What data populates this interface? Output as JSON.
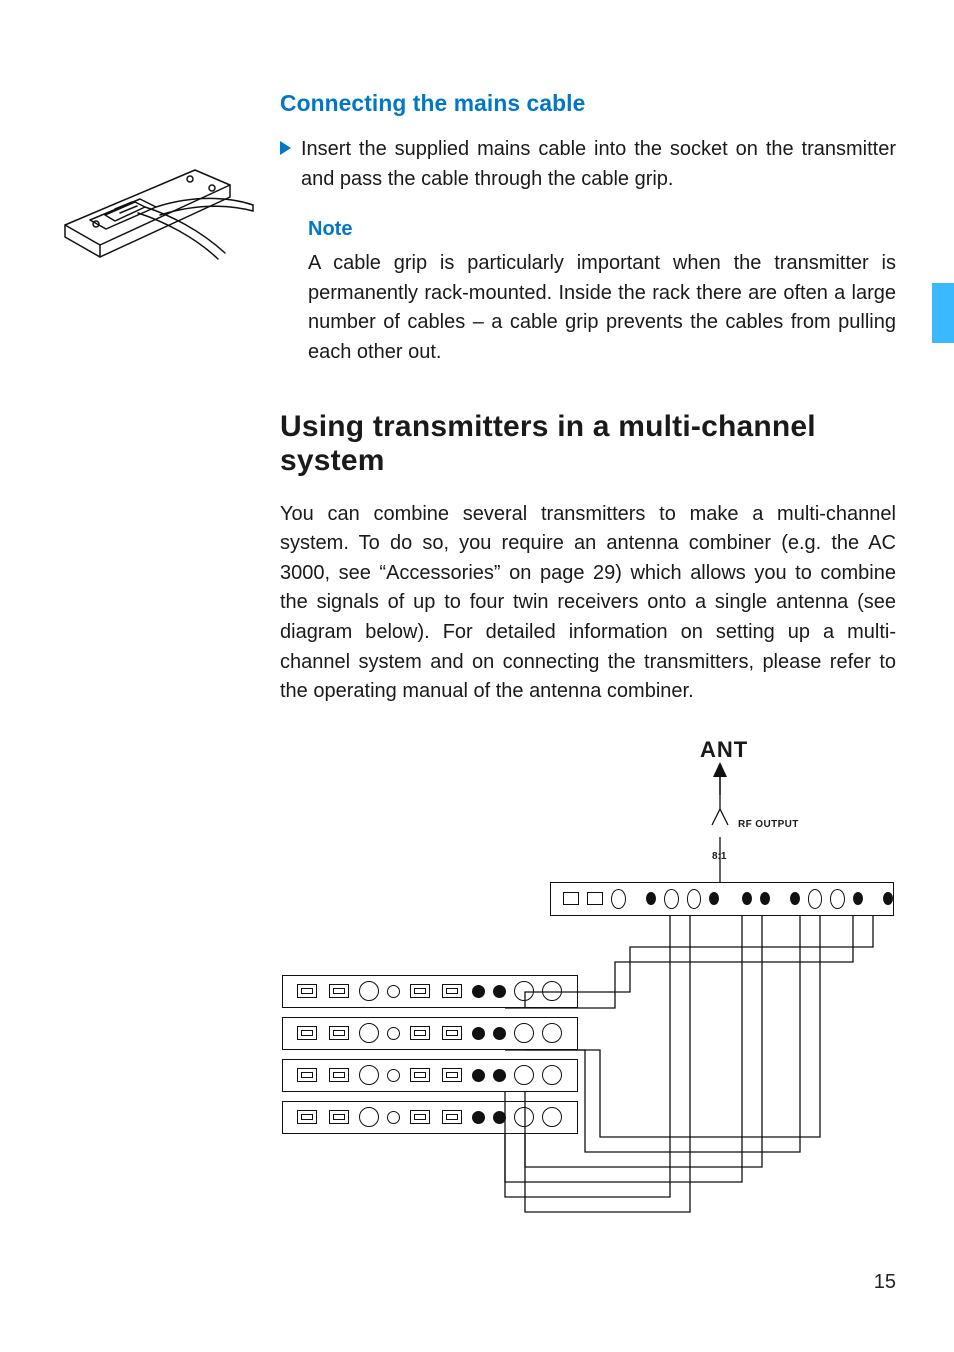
{
  "sections": {
    "mainsHeading": "Connecting the mains cable",
    "mainsStep": "Insert the supplied mains cable into the socket on the transmitter and pass the cable through the cable grip.",
    "noteHeading": "Note",
    "noteBody": "A cable grip is particularly important when the transmitter is permanently rack-mounted. Inside the rack there are often a large number of cables – a cable grip prevents the cables from pulling each other out.",
    "multiHeading": "Using transmitters in a multi-channel system",
    "multiBody": "You can combine several transmitters to make a multi-channel system. To do so, you require an antenna combiner (e.g. the AC 3000, see “Accessories” on page 29) which allows you to combine the signals of up to four twin receivers onto a single antenna (see diagram below). For detailed information on setting up a multi-channel system and on connecting the transmitters, please refer to the operating manual of the antenna combiner."
  },
  "diagram": {
    "antLabel": "ANT",
    "rfOutput": "RF OUTPUT",
    "ratio": "8:1"
  },
  "pageNumber": "15"
}
